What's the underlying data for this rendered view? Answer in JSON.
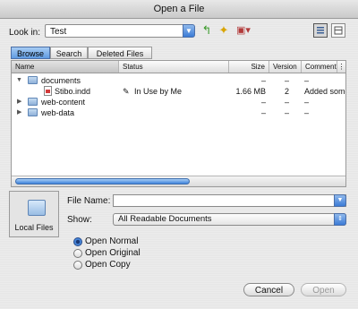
{
  "window": {
    "title": "Open a File"
  },
  "lookin": {
    "label": "Look in:",
    "value": "Test"
  },
  "toolbar_icons": [
    "up-folder-icon",
    "new-folder-icon",
    "toolbox-icon",
    "list-view-icon",
    "detail-view-icon"
  ],
  "tabs": [
    {
      "label": "Browse",
      "active": true
    },
    {
      "label": "Search",
      "active": false
    },
    {
      "label": "Deleted Files",
      "active": false
    }
  ],
  "columns": [
    "Name",
    "Status",
    "Size",
    "Version",
    "Comment"
  ],
  "rows": [
    {
      "name": "documents",
      "status": "",
      "size": "–",
      "version": "–",
      "comment": "–",
      "expanded": true,
      "indent": 0,
      "kind": "folder"
    },
    {
      "name": "Stibo.indd",
      "status": "In Use by Me",
      "size": "1.66 MB",
      "version": "2",
      "comment": "Added some",
      "expanded": null,
      "indent": 1,
      "kind": "file"
    },
    {
      "name": "web-content",
      "status": "",
      "size": "–",
      "version": "–",
      "comment": "–",
      "expanded": false,
      "indent": 0,
      "kind": "folder"
    },
    {
      "name": "web-data",
      "status": "",
      "size": "–",
      "version": "–",
      "comment": "–",
      "expanded": false,
      "indent": 0,
      "kind": "folder"
    }
  ],
  "sidebar": {
    "label": "Local Files"
  },
  "file_name": {
    "label": "File Name:",
    "value": ""
  },
  "show": {
    "label": "Show:",
    "value": "All Readable Documents"
  },
  "open_options": [
    {
      "label": "Open Normal",
      "selected": true
    },
    {
      "label": "Open Original",
      "selected": false
    },
    {
      "label": "Open Copy",
      "selected": false
    }
  ],
  "buttons": {
    "cancel": "Cancel",
    "open": "Open"
  }
}
